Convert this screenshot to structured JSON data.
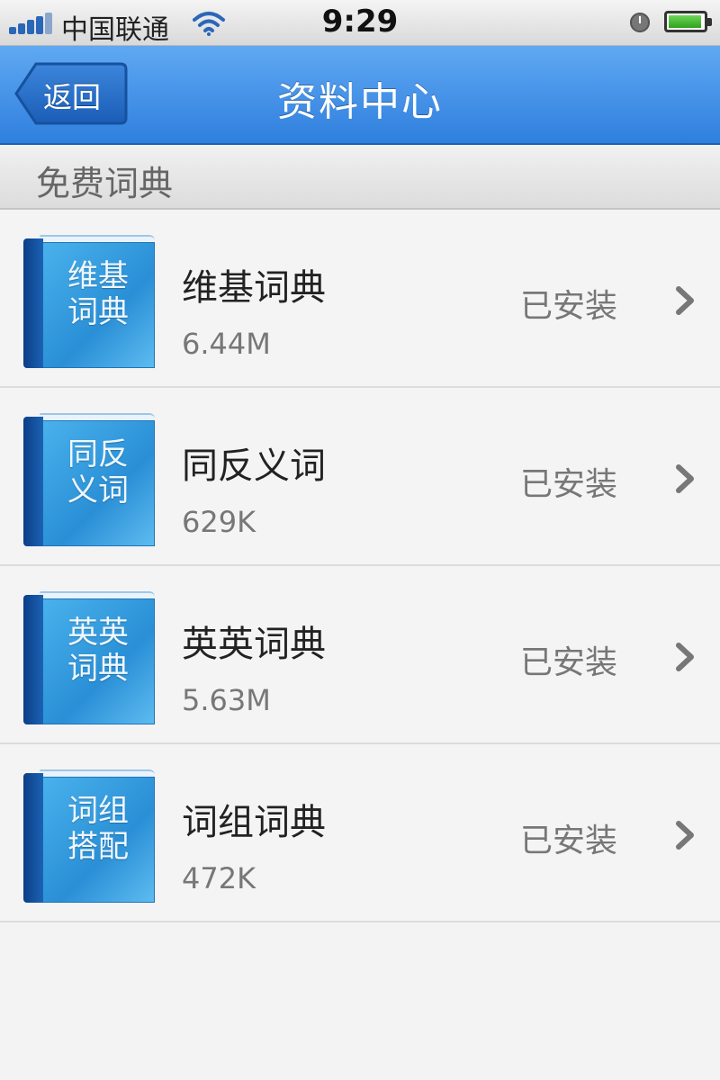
{
  "status_bar": {
    "carrier": "中国联通",
    "time": "9:29",
    "icons": [
      "signal-icon",
      "wifi-icon",
      "clock-icon",
      "battery-icon"
    ]
  },
  "nav": {
    "back_label": "返回",
    "title": "资料中心"
  },
  "section": {
    "title": "免费词典"
  },
  "dictionaries": [
    {
      "cover_line1": "维基",
      "cover_line2": "词典",
      "name": "维基词典",
      "size": "6.44M",
      "status": "已安装"
    },
    {
      "cover_line1": "同反",
      "cover_line2": "义词",
      "name": "同反义词",
      "size": "629K",
      "status": "已安装"
    },
    {
      "cover_line1": "英英",
      "cover_line2": "词典",
      "name": "英英词典",
      "size": "5.63M",
      "status": "已安装"
    },
    {
      "cover_line1": "词组",
      "cover_line2": "搭配",
      "name": "词组词典",
      "size": "472K",
      "status": "已安装"
    }
  ],
  "colors": {
    "nav_blue": "#3a8ae6",
    "book_blue": "#2a8fd6",
    "background": "#f4f4f4"
  }
}
